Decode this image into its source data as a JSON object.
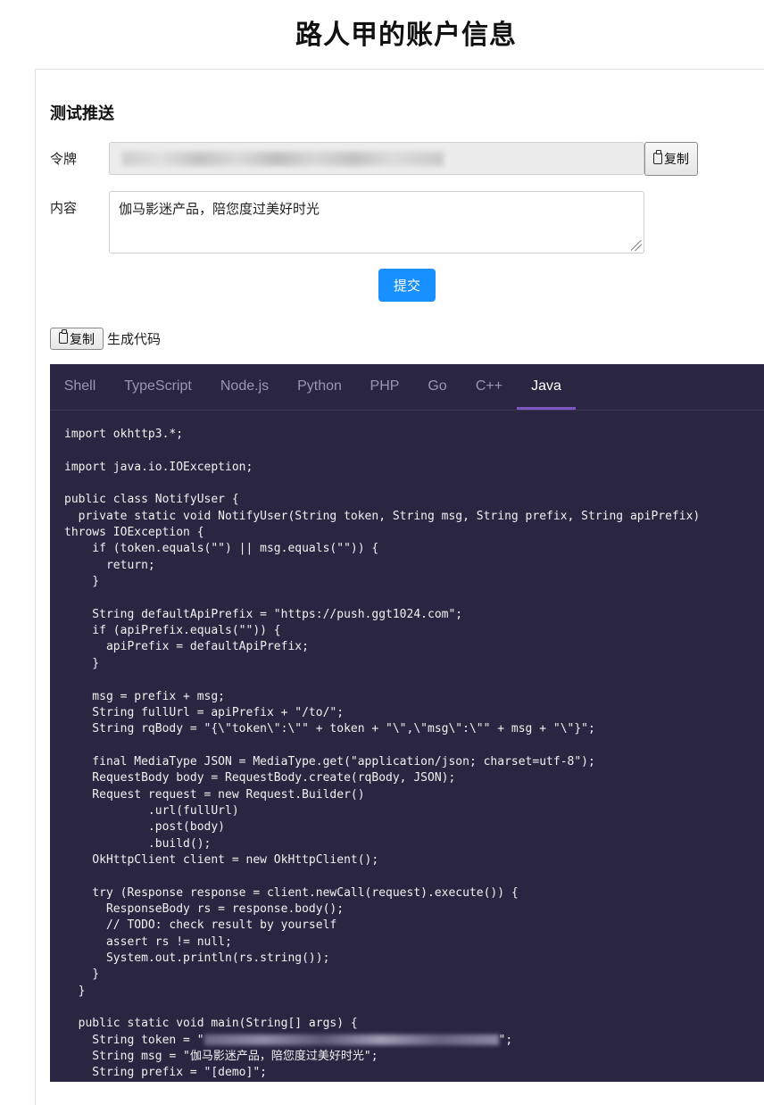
{
  "header": {
    "title": "路人甲的账户信息"
  },
  "test_push": {
    "section_title": "测试推送",
    "token_label": "令牌",
    "token_value": "",
    "token_copy_label": "复制",
    "content_label": "内容",
    "content_value": "伽马影迷产品，陪您度过美好时光",
    "submit_label": "提交"
  },
  "codegen": {
    "copy_label": "复制",
    "title": "生成代码",
    "tabs": [
      "Shell",
      "TypeScript",
      "Node.js",
      "Python",
      "PHP",
      "Go",
      "C++",
      "Java"
    ],
    "active_tab": "Java",
    "code_part1": "import okhttp3.*;\n\nimport java.io.IOException;\n\npublic class NotifyUser {\n  private static void NotifyUser(String token, String msg, String prefix, String apiPrefix)\nthrows IOException {\n    if (token.equals(\"\") || msg.equals(\"\")) {\n      return;\n    }\n\n    String defaultApiPrefix = \"https://push.ggt1024.com\";\n    if (apiPrefix.equals(\"\")) {\n      apiPrefix = defaultApiPrefix;\n    }\n\n    msg = prefix + msg;\n    String fullUrl = apiPrefix + \"/to/\";\n    String rqBody = \"{\\\"token\\\":\\\"\" + token + \"\\\",\\\"msg\\\":\\\"\" + msg + \"\\\"}\";\n\n    final MediaType JSON = MediaType.get(\"application/json; charset=utf-8\");\n    RequestBody body = RequestBody.create(rqBody, JSON);\n    Request request = new Request.Builder()\n            .url(fullUrl)\n            .post(body)\n            .build();\n    OkHttpClient client = new OkHttpClient();\n\n    try (Response response = client.newCall(request).execute()) {\n      ResponseBody rs = response.body();\n      // TODO: check result by yourself\n      assert rs != null;\n      System.out.println(rs.string());\n    }\n  }\n\n  public static void main(String[] args) {\n    String token = \"",
    "code_part2": "\";\n    String msg = \"伽马影迷产品，陪您度过美好时光\";\n    String prefix = \"[demo]\";"
  }
}
